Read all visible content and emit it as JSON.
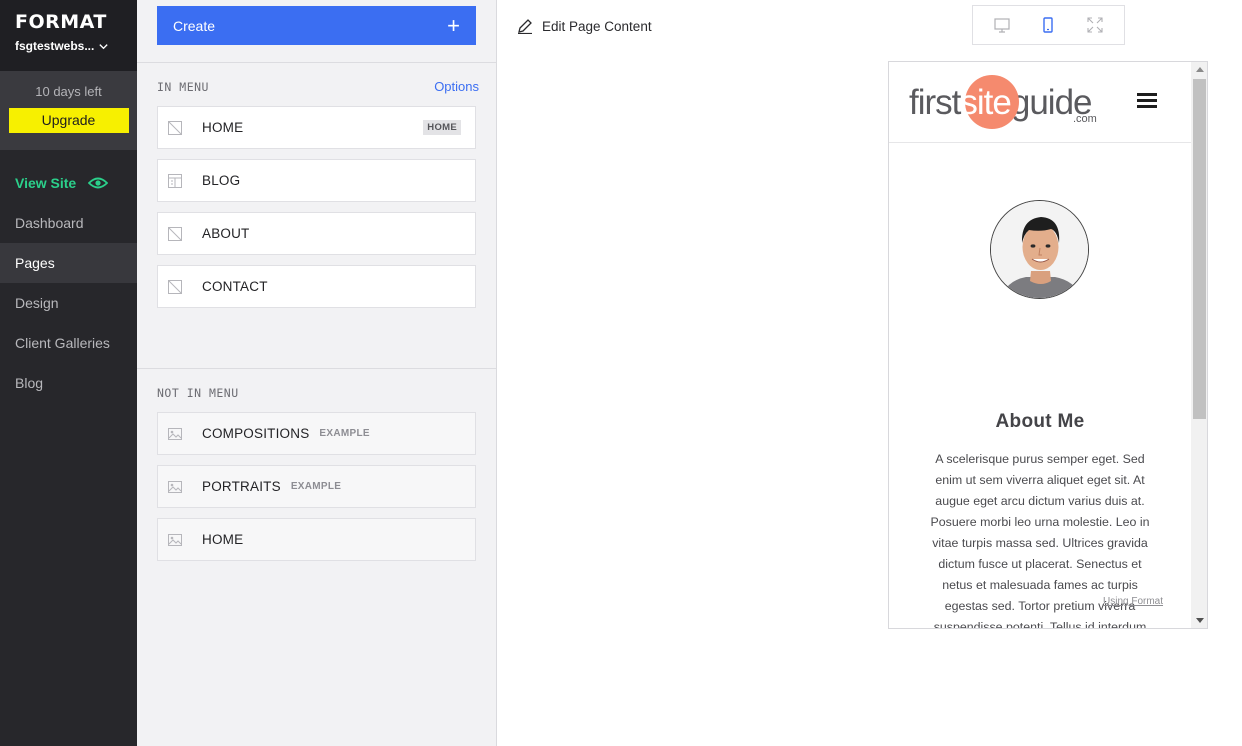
{
  "sidebar": {
    "brand": "FORMAT",
    "site_name": "fsgtestwebs...",
    "trial_text": "10 days left",
    "upgrade_label": "Upgrade",
    "nav": {
      "view_site": "View Site",
      "dashboard": "Dashboard",
      "pages": "Pages",
      "design": "Design",
      "client_galleries": "Client Galleries",
      "blog": "Blog"
    },
    "active_item": "Pages"
  },
  "panel": {
    "create_label": "Create",
    "create_icon": "+",
    "in_menu_label": "IN MENU",
    "options_label": "Options",
    "in_menu": [
      {
        "title": "HOME",
        "badge": "HOME",
        "icon": "page-icon"
      },
      {
        "title": "BLOG",
        "icon": "blog-icon"
      },
      {
        "title": "ABOUT",
        "icon": "page-icon"
      },
      {
        "title": "CONTACT",
        "icon": "page-icon"
      }
    ],
    "not_in_menu_label": "NOT IN MENU",
    "not_in_menu": [
      {
        "title": "COMPOSITIONS",
        "tag": "EXAMPLE",
        "icon": "gallery-icon"
      },
      {
        "title": "PORTRAITS",
        "tag": "EXAMPLE",
        "icon": "gallery-icon"
      },
      {
        "title": "HOME",
        "icon": "gallery-icon"
      }
    ]
  },
  "main": {
    "edit_label": "Edit Page Content",
    "devices": [
      "desktop-icon",
      "mobile-icon",
      "fullscreen-icon"
    ],
    "active_device": "mobile",
    "preview": {
      "logo_first": "first",
      "logo_site": "site",
      "logo_guide": "guide",
      "logo_com": ".com",
      "about_title": "About Me",
      "about_text": "A scelerisque purus semper eget. Sed enim ut sem viverra aliquet eget sit. At augue eget arcu dictum varius duis at. Posuere morbi leo urna molestie. Leo in vitae turpis massa sed. Ultrices gravida dictum fusce ut placerat. Senectus et netus et malesuada fames ac turpis egestas sed. Tortor pretium viverra suspendisse potenti. Tellus id interdum",
      "using_format": "Using Format"
    }
  },
  "colors": {
    "accent": "#3b6ef2",
    "upgrade": "#f7f000",
    "view_site": "#2bd08b",
    "logo_circle": "#f58a6e"
  }
}
